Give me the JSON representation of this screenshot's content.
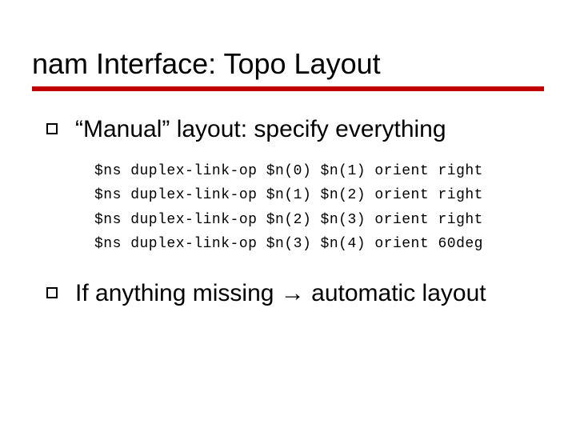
{
  "title": "nam Interface: Topo Layout",
  "bullets": {
    "b1": "“Manual” layout: specify everything",
    "b2_pre": "If anything missing ",
    "b2_arrow": "→",
    "b2_post": " automatic layout"
  },
  "code": {
    "l1": "$ns duplex-link-op $n(0) $n(1) orient right",
    "l2": "$ns duplex-link-op $n(1) $n(2) orient right",
    "l3": "$ns duplex-link-op $n(2) $n(3) orient right",
    "l4": "$ns duplex-link-op $n(3) $n(4) orient 60deg"
  }
}
